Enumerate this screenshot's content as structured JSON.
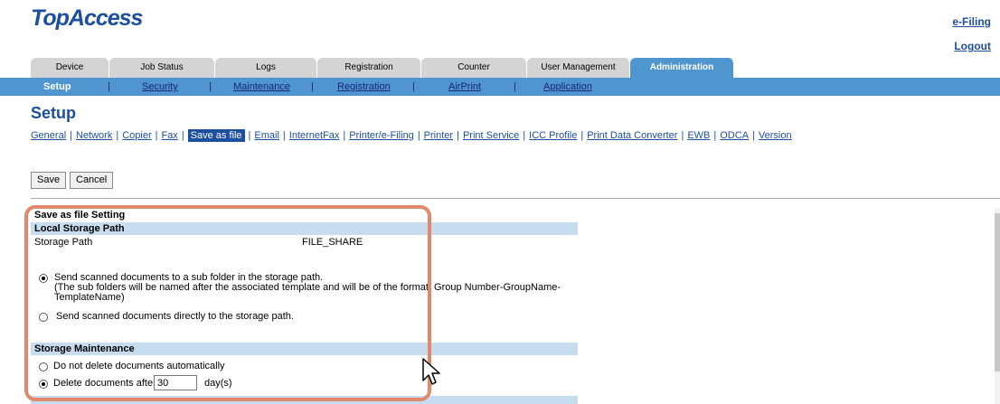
{
  "header": {
    "logo": "TopAccess",
    "efiling_link": "e-Filing",
    "logout_link": "Logout"
  },
  "tabs": [
    "Device",
    "Job Status",
    "Logs",
    "Registration",
    "Counter",
    "User Management",
    "Administration"
  ],
  "active_tab": "Administration",
  "subnav": [
    "Setup",
    "Security",
    "Maintenance",
    "Registration",
    "AirPrint",
    "Application"
  ],
  "active_subnav": "Setup",
  "page_title": "Setup",
  "setup_links": [
    "General",
    "Network",
    "Copier",
    "Fax",
    "Save as file",
    "Email",
    "InternetFax",
    "Printer/e-Filing",
    "Printer",
    "Print Service",
    "ICC Profile",
    "Print Data Converter",
    "EWB",
    "ODCA",
    "Version"
  ],
  "active_setup_link": "Save as file",
  "buttons": {
    "save": "Save",
    "cancel": "Cancel"
  },
  "section_title": "Save as file Setting",
  "local_storage": {
    "header": "Local Storage Path",
    "path_label": "Storage Path",
    "path_value": "FILE_SHARE",
    "option_subfolder_line1": "Send scanned documents to a sub folder in the storage path.",
    "option_subfolder_line2": "(The sub folders will be named after the associated template and will be of the format: Group Number-GroupName-",
    "option_subfolder_line3": "TemplateName)",
    "option_direct": "Send scanned documents directly to the storage path.",
    "selected": "subfolder"
  },
  "storage_maintenance": {
    "header": "Storage Maintenance",
    "option_no_delete": "Do not delete documents automatically",
    "option_delete_after": "Delete documents after",
    "days_value": "30",
    "days_unit": "day(s)",
    "selected": "delete_after"
  },
  "colors": {
    "brand_blue": "#1c4fa0",
    "tab_active": "#4f95d0",
    "section_band": "#c7dcef",
    "highlight": "#e2896b"
  }
}
